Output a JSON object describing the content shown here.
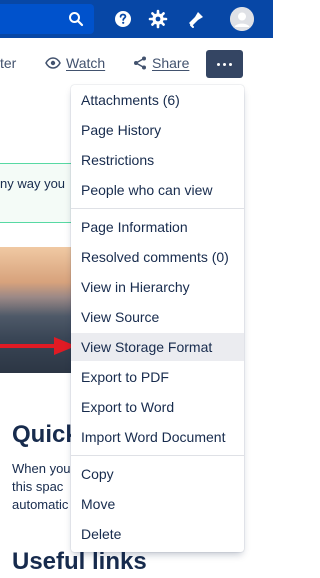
{
  "actions": {
    "partial_left_label": "ter",
    "watch_label": "Watch",
    "share_label": "Share"
  },
  "content": {
    "callout_text": "ny way you",
    "quick_heading": "Quick",
    "body_lines": [
      "When you",
      "this spac",
      "automatic"
    ],
    "useful_heading": "Useful links"
  },
  "menu": {
    "groups": [
      [
        "Attachments (6)",
        "Page History",
        "Restrictions",
        "People who can view"
      ],
      [
        "Page Information",
        "Resolved comments (0)",
        "View in Hierarchy",
        "View Source",
        "View Storage Format",
        "Export to PDF",
        "Export to Word",
        "Import Word Document"
      ],
      [
        "Copy",
        "Move",
        "Delete"
      ]
    ],
    "highlighted_item": "View Storage Format"
  },
  "colors": {
    "nav_bg": "#0747a6",
    "highlight_bg": "#ebecf0",
    "arrow": "#e01b24",
    "more_button": "#344563"
  }
}
